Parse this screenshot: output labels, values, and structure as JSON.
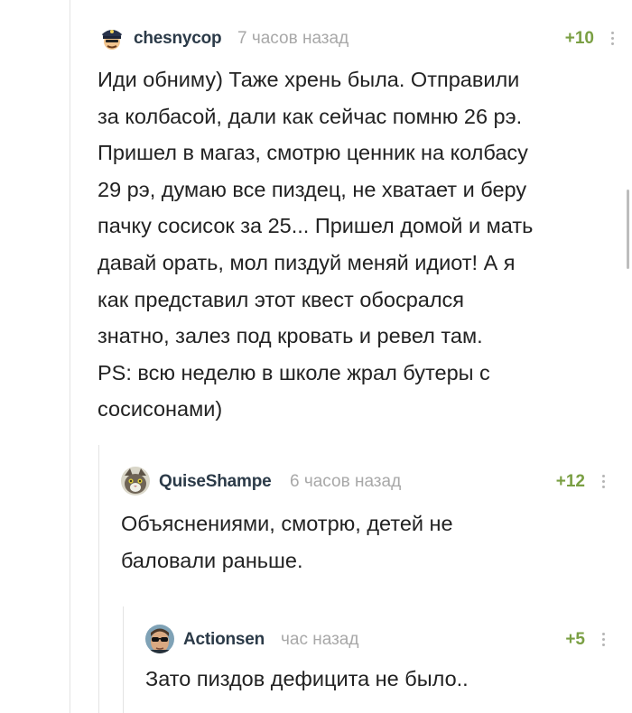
{
  "comments": [
    {
      "username": "chesnycop",
      "timestamp": "7 часов назад",
      "rating": "+10",
      "avatar_icon": "police-officer-avatar",
      "text": "Иди обниму) Таже хрень была. Отправили\nза колбасой, дали как сейчас помню 26 рэ.\nПришел в магаз, смотрю ценник на колбасу\n29 рэ, думаю все пиздец, не хватает и беру\nпачку сосисок за 25... Пришел домой и мать\nдавай орать, мол пиздуй меняй идиот! А я\nкак представил этот квест обосрался\nзнатно, залез под кровать и ревел там.\nPS: всю неделю в школе жрал бутеры с\nсосисонами)"
    },
    {
      "username": "QuiseShampe",
      "timestamp": "6 часов назад",
      "rating": "+12",
      "avatar_icon": "cat-avatar",
      "text": "Объяснениями, смотрю, детей не\nбаловали раньше."
    },
    {
      "username": "Actionsen",
      "timestamp": "час назад",
      "rating": "+5",
      "avatar_icon": "man-sunglasses-avatar",
      "text": "Зато пиздов дефицита не было.."
    }
  ],
  "colors": {
    "username": "#2b3a48",
    "timestamp": "#a8a8a8",
    "rating_positive": "#7a9f43",
    "text": "#222222",
    "thread_line": "#e3e3e3"
  },
  "icons": {
    "more": "vertical-ellipsis-icon"
  }
}
